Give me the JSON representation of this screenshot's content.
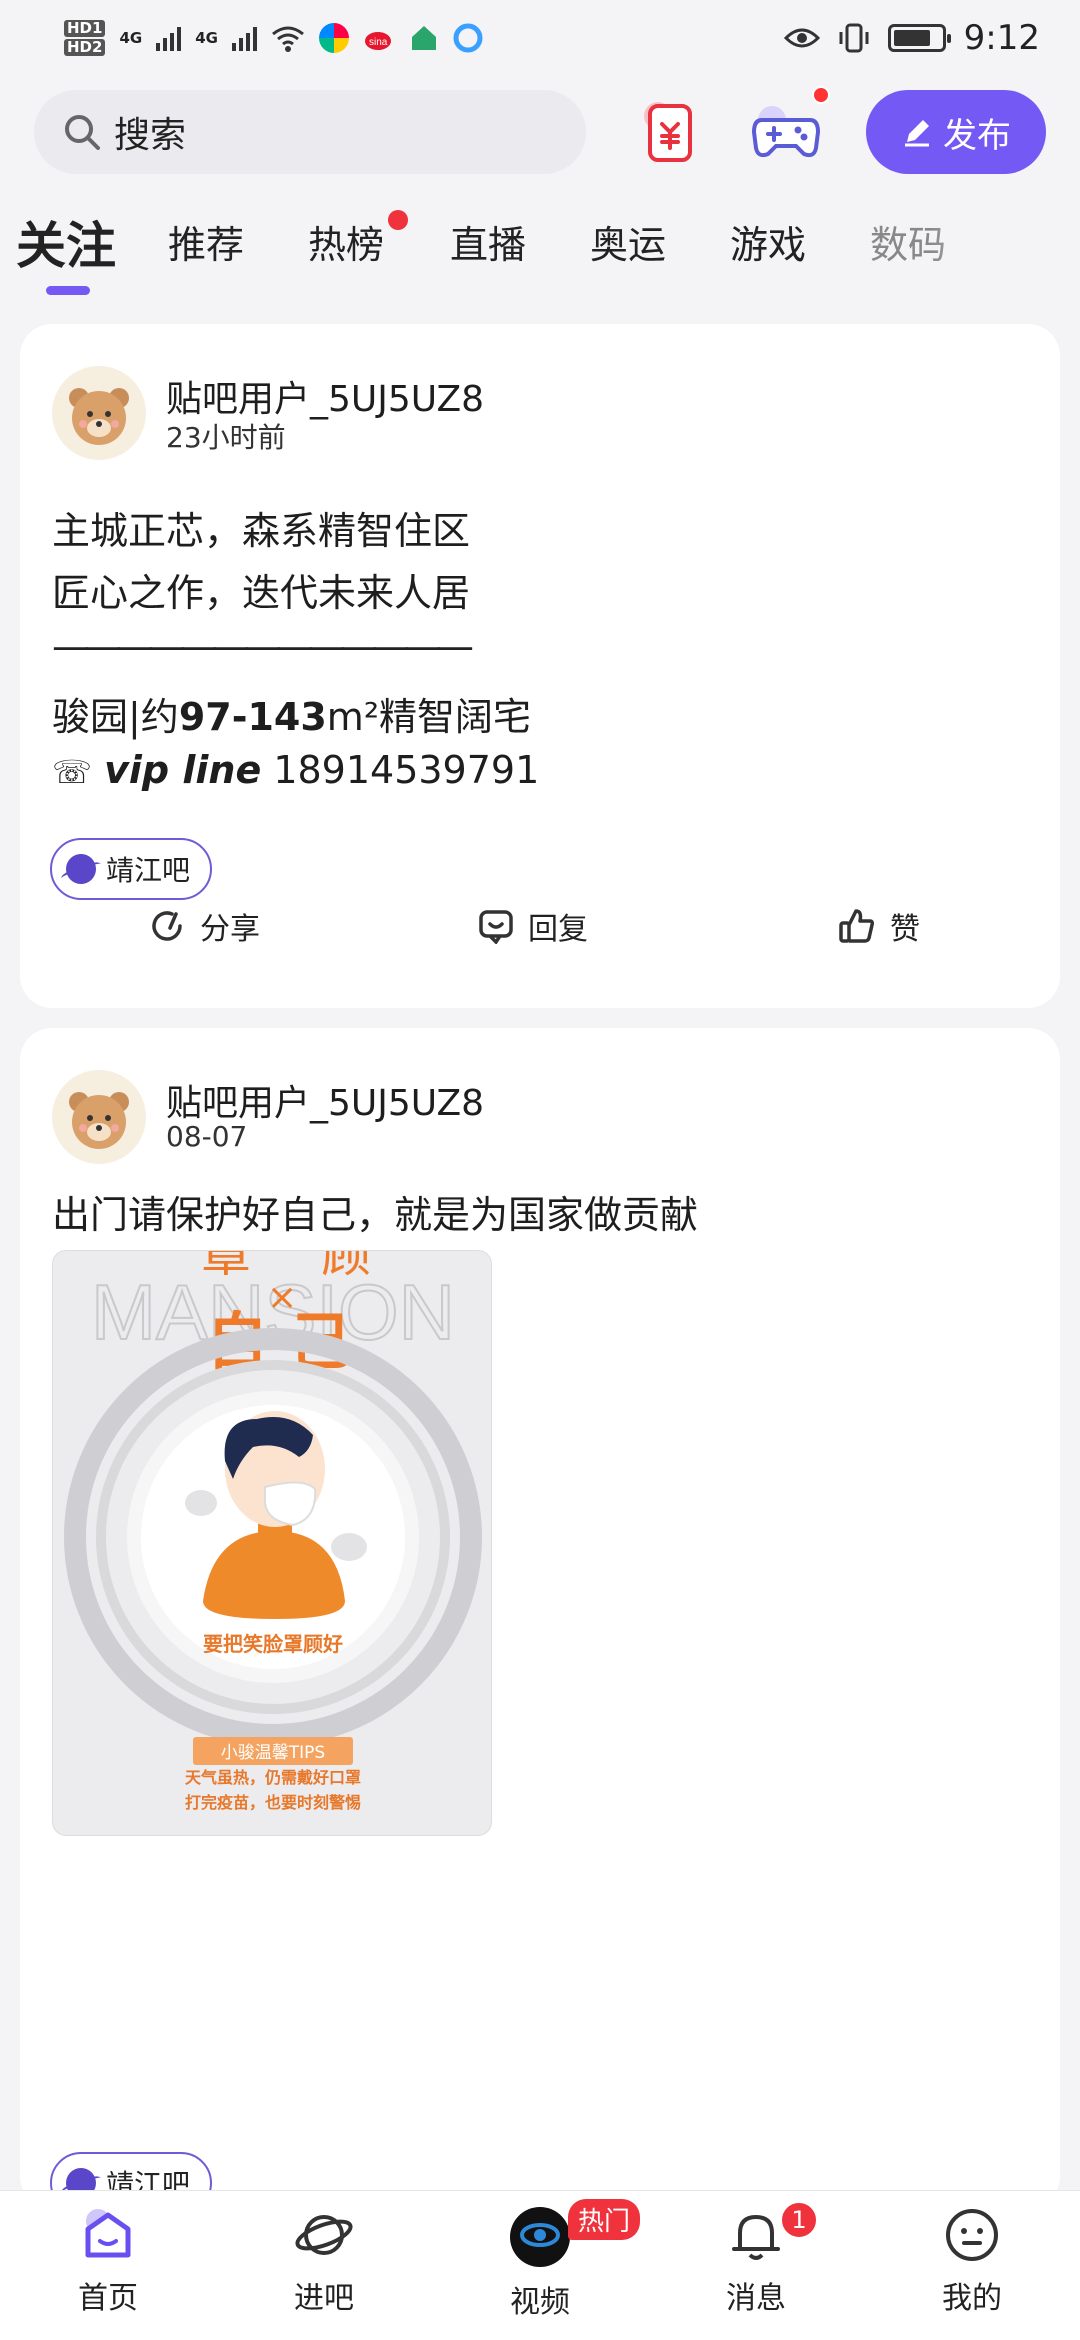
{
  "status_bar": {
    "time": "9:12",
    "signal1": "4G",
    "signal2": "4G",
    "hd1": "HD 1",
    "hd2": "HD 2"
  },
  "header": {
    "search_placeholder": "搜索",
    "publish_label": "发布"
  },
  "tabs": [
    {
      "label": "关注",
      "active": true
    },
    {
      "label": "推荐"
    },
    {
      "label": "热榜",
      "dot": true
    },
    {
      "label": "直播"
    },
    {
      "label": "奥运"
    },
    {
      "label": "游戏"
    },
    {
      "label": "数码"
    }
  ],
  "posts": [
    {
      "user": "贴吧用户_5UJ5UZ8",
      "time": "23小时前",
      "lines": [
        "主城正芯，森系精智住区",
        "匠心之作，迭代未来人居",
        "—————————————"
      ],
      "line4_prefix": "骏园|约",
      "line4_bold": "97-143",
      "line4_unit": "m²",
      "line4_suffix": "精智阔宅",
      "vip_icon": "☏",
      "vip_label": "vip line",
      "phone": "18914539791",
      "forum": "靖江吧",
      "actions": {
        "share": "分享",
        "reply": "回复",
        "like": "赞"
      }
    },
    {
      "user": "贴吧用户_5UJ5UZ8",
      "time": "08-07",
      "text": "出门请保护好自己，就是为国家做贡献",
      "forum": "靖江吧",
      "poster": {
        "top_text": "罩",
        "top_text2": "顾",
        "x_mark": "×",
        "big_text": "自 己",
        "watermark": "MANSION",
        "caption": "要把笑脸罩顾好",
        "tips_title": "小骏温馨TIPS",
        "tips_line1": "天气虽热，仍需戴好口罩",
        "tips_line2": "打完疫苗，也要时刻警惕"
      }
    }
  ],
  "bottom_nav": [
    {
      "label": "首页",
      "active": true
    },
    {
      "label": "进吧"
    },
    {
      "label": "视频",
      "badge": "热门"
    },
    {
      "label": "消息",
      "badge": "1"
    },
    {
      "label": "我的"
    }
  ],
  "colors": {
    "accent": "#7559f5",
    "badge_red": "#f0323c",
    "orange": "#f08a2c"
  }
}
